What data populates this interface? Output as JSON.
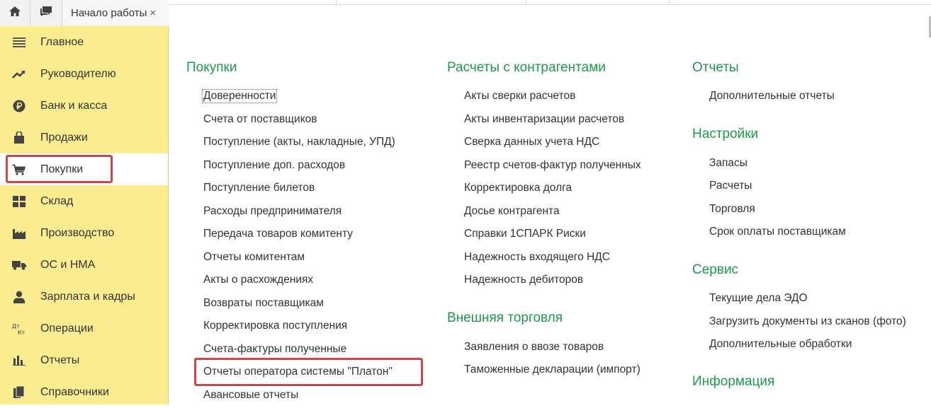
{
  "topbar": {
    "home_icon": "home-icon",
    "chat_icon": "chat-icon",
    "tab_label": "Начало работы",
    "tab_close": "×"
  },
  "sidebar": {
    "background": "#fbec8f",
    "active_item": "Покупки",
    "items": [
      {
        "label": "Главное",
        "icon": "menu-lines-icon"
      },
      {
        "label": "Руководителю",
        "icon": "trend-up-icon"
      },
      {
        "label": "Банк и касса",
        "icon": "ruble-coin-icon"
      },
      {
        "label": "Продажи",
        "icon": "shopping-bag-icon"
      },
      {
        "label": "Покупки",
        "icon": "shopping-cart-icon"
      },
      {
        "label": "Склад",
        "icon": "warehouse-grid-icon"
      },
      {
        "label": "Производство",
        "icon": "factory-icon"
      },
      {
        "label": "ОС и НМА",
        "icon": "truck-icon"
      },
      {
        "label": "Зарплата и кадры",
        "icon": "person-icon"
      },
      {
        "label": "Операции",
        "icon": "debit-credit-icon"
      },
      {
        "label": "Отчеты",
        "icon": "bar-chart-icon"
      },
      {
        "label": "Справочники",
        "icon": "books-icon"
      }
    ]
  },
  "main": {
    "accent_color": "#1e9a4c",
    "highlight_color": "#c8494a",
    "col1": {
      "sections": [
        {
          "title": "Покупки",
          "links": [
            "Доверенности",
            "Счета от поставщиков",
            "Поступление (акты, накладные, УПД)",
            "Поступление доп. расходов",
            "Поступление билетов",
            "Расходы предпринимателя",
            "Передача товаров комитенту",
            "Отчеты комитентам",
            "Акты о расхождениях",
            "Возвраты поставщикам",
            "Корректировка поступления",
            "Счета-фактуры полученные",
            "Отчеты оператора системы \"Платон\"",
            "Авансовые отчеты"
          ]
        }
      ]
    },
    "col2": {
      "sections": [
        {
          "title": "Расчеты с контрагентами",
          "links": [
            "Акты сверки расчетов",
            "Акты инвентаризации расчетов",
            "Сверка данных учета НДС",
            "Реестр счетов-фактур полученных",
            "Корректировка долга",
            "Досье контрагента",
            "Справки 1СПАРК Риски",
            "Надежность входящего НДС",
            "Надежность дебиторов"
          ]
        },
        {
          "title": "Внешняя торговля",
          "links": [
            "Заявления о ввозе товаров",
            "Таможенные декларации (импорт)"
          ]
        }
      ]
    },
    "col3": {
      "sections": [
        {
          "title": "Отчеты",
          "links": [
            "Дополнительные отчеты"
          ]
        },
        {
          "title": "Настройки",
          "links": [
            "Запасы",
            "Расчеты",
            "Торговля",
            "Срок оплаты поставщикам"
          ]
        },
        {
          "title": "Сервис",
          "links": [
            "Текущие дела ЭДО",
            "Загрузить документы из сканов (фото)",
            "Дополнительные обработки"
          ]
        },
        {
          "title": "Информация",
          "links": []
        }
      ]
    }
  }
}
